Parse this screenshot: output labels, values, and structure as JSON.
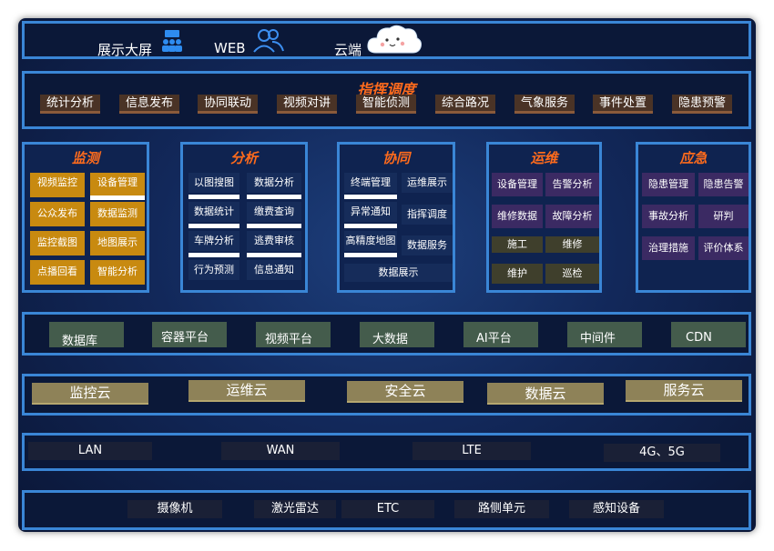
{
  "top": {
    "items": [
      "展示大屏",
      "WEB",
      "云端"
    ]
  },
  "command": {
    "title": "指挥调度",
    "buttons": [
      "统计分析",
      "信息发布",
      "协同联动",
      "视频对讲",
      "智能侦测",
      "综合路况",
      "气象服务",
      "事件处置",
      "隐患预警"
    ]
  },
  "modules": {
    "monitor": {
      "title": "监测",
      "cells": [
        "视频监控",
        "设备管理",
        "公众发布",
        "数据监测",
        "监控截图",
        "地图展示",
        "点播回看",
        "智能分析"
      ]
    },
    "analysis": {
      "title": "分析",
      "cells": [
        "以图搜图",
        "数据分析",
        "数据统计",
        "缴费查询",
        "车牌分析",
        "逃费审核",
        "行为预测",
        "信息通知"
      ]
    },
    "coord": {
      "title": "协同",
      "cells": [
        "终端管理",
        "运维展示",
        "异常通知",
        "指挥调度",
        "高精度地图",
        "数据服务",
        "数据展示"
      ]
    },
    "ops": {
      "title": "运维",
      "cells": [
        "设备管理",
        "告警分析",
        "维修数据",
        "故障分析",
        "施工",
        "维修",
        "维护",
        "巡检"
      ]
    },
    "emergency": {
      "title": "应急",
      "cells": [
        "隐患管理",
        "隐患告警",
        "事故分析",
        "研判",
        "治理措施",
        "评价体系"
      ]
    }
  },
  "platform": {
    "items": [
      "数据库",
      "容器平台",
      "视频平台",
      "大数据",
      "AI平台",
      "中间件",
      "CDN"
    ]
  },
  "cloud": {
    "items": [
      "监控云",
      "运维云",
      "安全云",
      "数据云",
      "服务云"
    ]
  },
  "network": {
    "items": [
      "LAN",
      "WAN",
      "LTE",
      "4G、5G"
    ]
  },
  "devices": {
    "items": [
      "摄像机",
      "激光雷达",
      "ETC",
      "路侧单元",
      "感知设备"
    ]
  },
  "colors": {
    "border": "#3a86d6",
    "title_orange": "#ff6b1c",
    "gold": "#c88a10",
    "purple": "#3b2a63",
    "khaki": "#8e8258",
    "green": "#445c4c"
  }
}
